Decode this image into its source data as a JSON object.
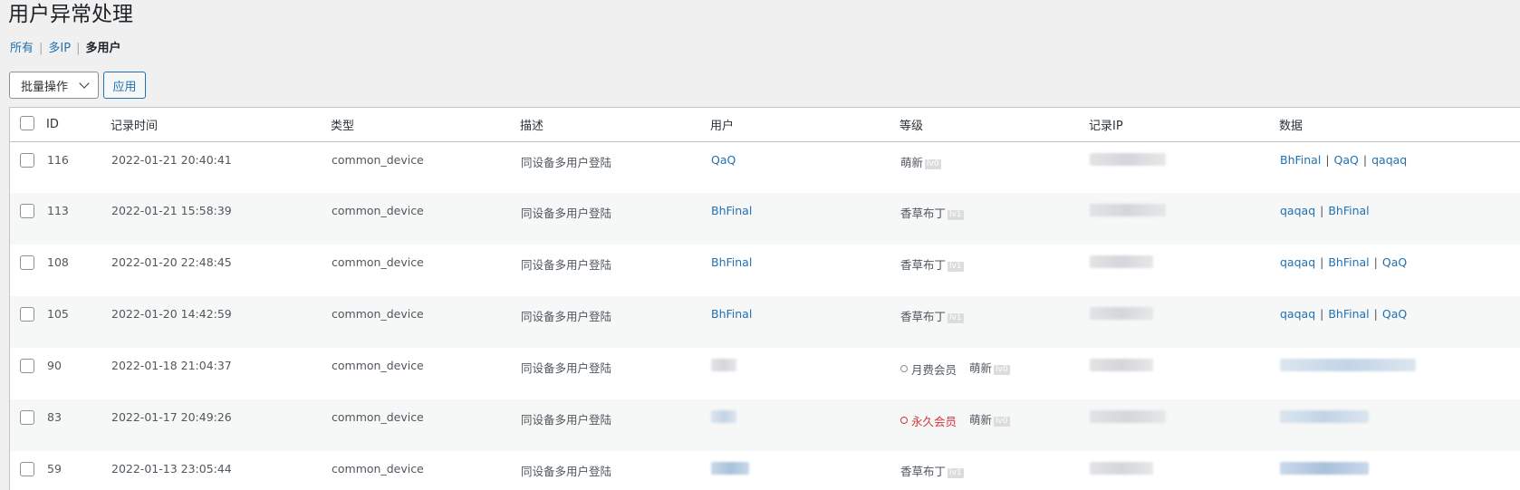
{
  "page": {
    "title": "用户异常处理"
  },
  "filters": {
    "all": "所有",
    "multi_ip": "多IP",
    "multi_user": "多用户",
    "separator": "|"
  },
  "bulk": {
    "select_label": "批量操作",
    "apply_label": "应用"
  },
  "table": {
    "columns": [
      "ID",
      "记录时间",
      "类型",
      "描述",
      "用户",
      "等级",
      "记录IP",
      "数据"
    ],
    "rows": [
      {
        "id": "116",
        "time": "2022-01-21 20:40:41",
        "type": "common_device",
        "desc": "同设备多用户登陆",
        "user": "QaQ",
        "level": "萌新",
        "level_tag": "lv0",
        "data": [
          "BhFinal",
          "QaQ",
          "qaqaq"
        ]
      },
      {
        "id": "113",
        "time": "2022-01-21 15:58:39",
        "type": "common_device",
        "desc": "同设备多用户登陆",
        "user": "BhFinal",
        "level": "香草布丁",
        "level_tag": "lv1",
        "data": [
          "qaqaq",
          "BhFinal"
        ]
      },
      {
        "id": "108",
        "time": "2022-01-20 22:48:45",
        "type": "common_device",
        "desc": "同设备多用户登陆",
        "user": "BhFinal",
        "level": "香草布丁",
        "level_tag": "lv1",
        "data": [
          "qaqaq",
          "BhFinal",
          "QaQ"
        ]
      },
      {
        "id": "105",
        "time": "2022-01-20 14:42:59",
        "type": "common_device",
        "desc": "同设备多用户登陆",
        "user": "BhFinal",
        "level": "香草布丁",
        "level_tag": "lv1",
        "data": [
          "qaqaq",
          "BhFinal",
          "QaQ"
        ]
      },
      {
        "id": "90",
        "time": "2022-01-18 21:04:37",
        "type": "common_device",
        "desc": "同设备多用户登陆",
        "user": "",
        "member": "月费会员",
        "member_color": "#8c8f94",
        "level": "萌新",
        "level_tag": "lv0",
        "data": []
      },
      {
        "id": "83",
        "time": "2022-01-17 20:49:26",
        "type": "common_device",
        "desc": "同设备多用户登陆",
        "user": "",
        "member": "永久会员",
        "member_color": "#d63638",
        "level": "萌新",
        "level_tag": "lv0",
        "data": []
      },
      {
        "id": "59",
        "time": "2022-01-13 23:05:44",
        "type": "common_device",
        "desc": "同设备多用户登陆",
        "user": "",
        "level": "香草布丁",
        "level_tag": "lv1",
        "data": []
      }
    ]
  },
  "colors": {
    "link": "#2271b1",
    "vip_red": "#d63638",
    "row_alt": "#f6f7f7"
  }
}
